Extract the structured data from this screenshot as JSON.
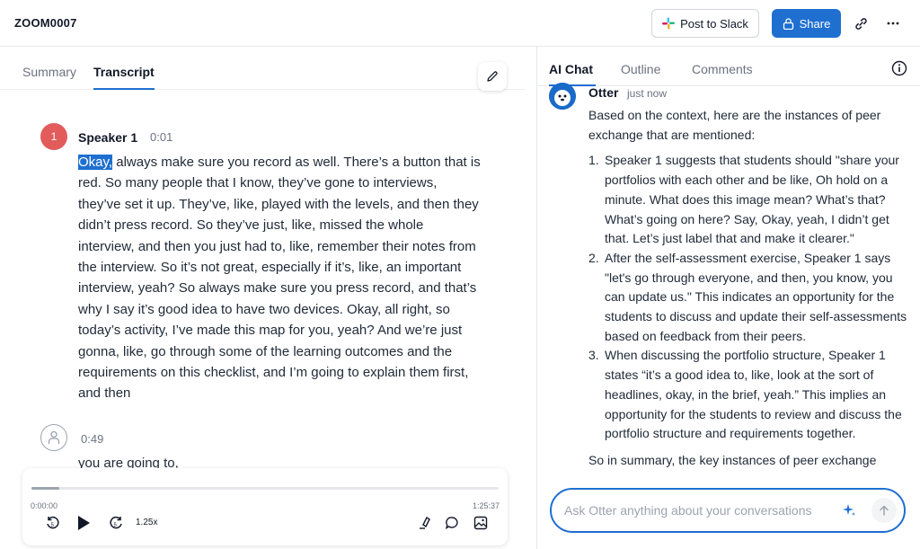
{
  "header": {
    "title": "ZOOM0007",
    "post_to_slack": "Post to Slack",
    "share": "Share"
  },
  "left_tabs": [
    {
      "label": "Summary",
      "active": false
    },
    {
      "label": "Transcript",
      "active": true
    }
  ],
  "transcript": {
    "speaker1": {
      "avatar": "1",
      "name": "Speaker 1",
      "time": "0:01",
      "highlight": "Okay,",
      "text": " always make sure you record as well. There’s a button that is red. So many people that I know, they’ve gone to interviews, they’ve set it up. They’ve, like, played with the levels, and then they didn’t press record. So they’ve just, like, missed the whole interview, and then you just had to, like, remember their notes from the interview. So it’s not great, especially if it’s, like, an important interview, yeah? So always make sure you press record, and that’s why I say it’s good idea  to have two devices. Okay, all right, so today’s activity, I’ve made this map for you, yeah? And we’re just gonna, like, go through some of the learning outcomes and the requirements on this checklist, and I’m going to explain them first, and then"
    },
    "speaker2": {
      "time": "0:49",
      "text": "you are going to,"
    }
  },
  "player": {
    "current": "0:00:00",
    "total": "1:25:37",
    "speed": "1.25x",
    "progress_fraction": 0.06
  },
  "right_tabs": [
    {
      "label": "AI Chat",
      "active": true
    },
    {
      "label": "Outline",
      "active": false
    },
    {
      "label": "Comments",
      "active": false
    }
  ],
  "chat": {
    "author": "Otter",
    "time": "just now",
    "intro": "Based on the context, here are the instances of peer exchange that are mentioned:",
    "items": [
      {
        "num": "1.",
        "text": "Speaker 1 suggests that students should \"share your portfolios with each other and be like, Oh hold on a minute. What does this image mean? What’s that? What’s going on here? Say, Okay, yeah, I didn’t get that. Let’s just label that and make it clearer.\""
      },
      {
        "num": "2.",
        "text": "After the self-assessment exercise, Speaker 1 says \"let's go through everyone, and then, you know, you can update us.\" This indicates an opportunity for the students to discuss and update their self-assessments based on feedback from their peers."
      },
      {
        "num": "3.",
        "text": "When discussing the portfolio structure, Speaker 1 states “it’s a good idea to, like, look at the sort of headlines, okay, in the brief, yeah.” This implies an opportunity for the students to review and discuss the portfolio structure and requirements together."
      }
    ],
    "summary": "So in summary, the key instances of peer exchange",
    "input_placeholder": "Ask Otter anything about your conversations"
  },
  "icons": {
    "slack": "slack-icon",
    "share": "lock-icon",
    "link": "link-icon",
    "more": "more-icon",
    "edit": "pencil-icon",
    "info": "info-icon",
    "sparkle": "sparkle-icon",
    "send": "arrow-up-icon"
  },
  "colors": {
    "accent": "#1f6fd1",
    "speaker1": "#e25c5c"
  }
}
